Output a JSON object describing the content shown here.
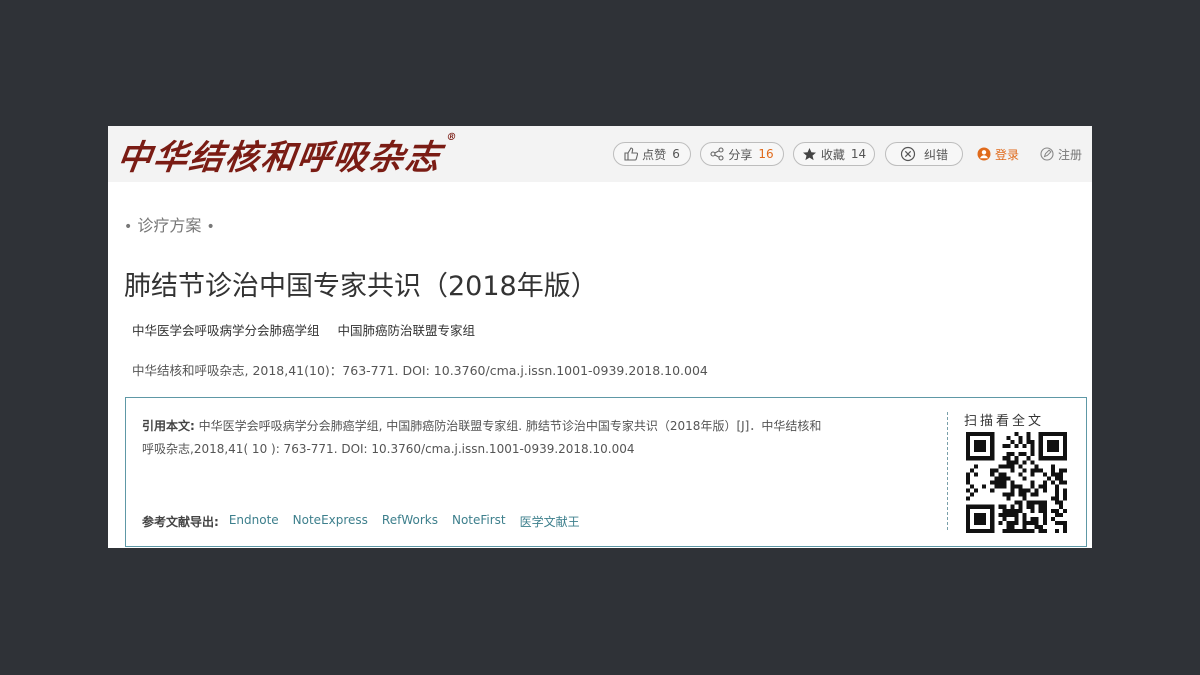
{
  "header": {
    "logo_text": "中华结核和呼吸杂志",
    "logo_reg": "®",
    "like": {
      "label": "点赞",
      "count": "6",
      "icon": "thumbs-up-icon"
    },
    "share": {
      "label": "分享",
      "count": "16",
      "icon": "share-icon"
    },
    "collect": {
      "label": "收藏",
      "count": "14",
      "icon": "star-icon"
    },
    "correct": {
      "label": "纠错",
      "icon": "correction-icon"
    },
    "login": {
      "label": "登录",
      "icon": "user-icon",
      "color": "#e06a1b"
    },
    "register": {
      "label": "注册",
      "icon": "edit-icon"
    }
  },
  "article": {
    "section_label": "诊疗方案",
    "section_dot": "•",
    "title": "肺结节诊治中国专家共识（2018年版）",
    "authors": [
      "中华医学会呼吸病学分会肺癌学组",
      "中国肺癌防治联盟专家组"
    ],
    "journal_line": "中华结核和呼吸杂志, 2018,41(10)：763-771. DOI: 10.3760/cma.j.issn.1001-0939.2018.10.004"
  },
  "citation": {
    "label": "引用本文:",
    "text_line1": "中华医学会呼吸病学分会肺癌学组, 中国肺癌防治联盟专家组. 肺结节诊治中国专家共识（2018年版）[J]．中华结核和",
    "text_line2": "呼吸杂志,2018,41( 10 ): 763-771. DOI: 10.3760/cma.j.issn.1001-0939.2018.10.004",
    "export_label": "参考文献导出:",
    "export_links": [
      "Endnote",
      "NoteExpress",
      "RefWorks",
      "NoteFirst",
      "医学文献王"
    ],
    "scan_label": "扫描看全文"
  },
  "colors": {
    "background": "#2f3237",
    "accent": "#3d7f8c",
    "logo": "#7a1c14",
    "highlight": "#e06a1b"
  }
}
